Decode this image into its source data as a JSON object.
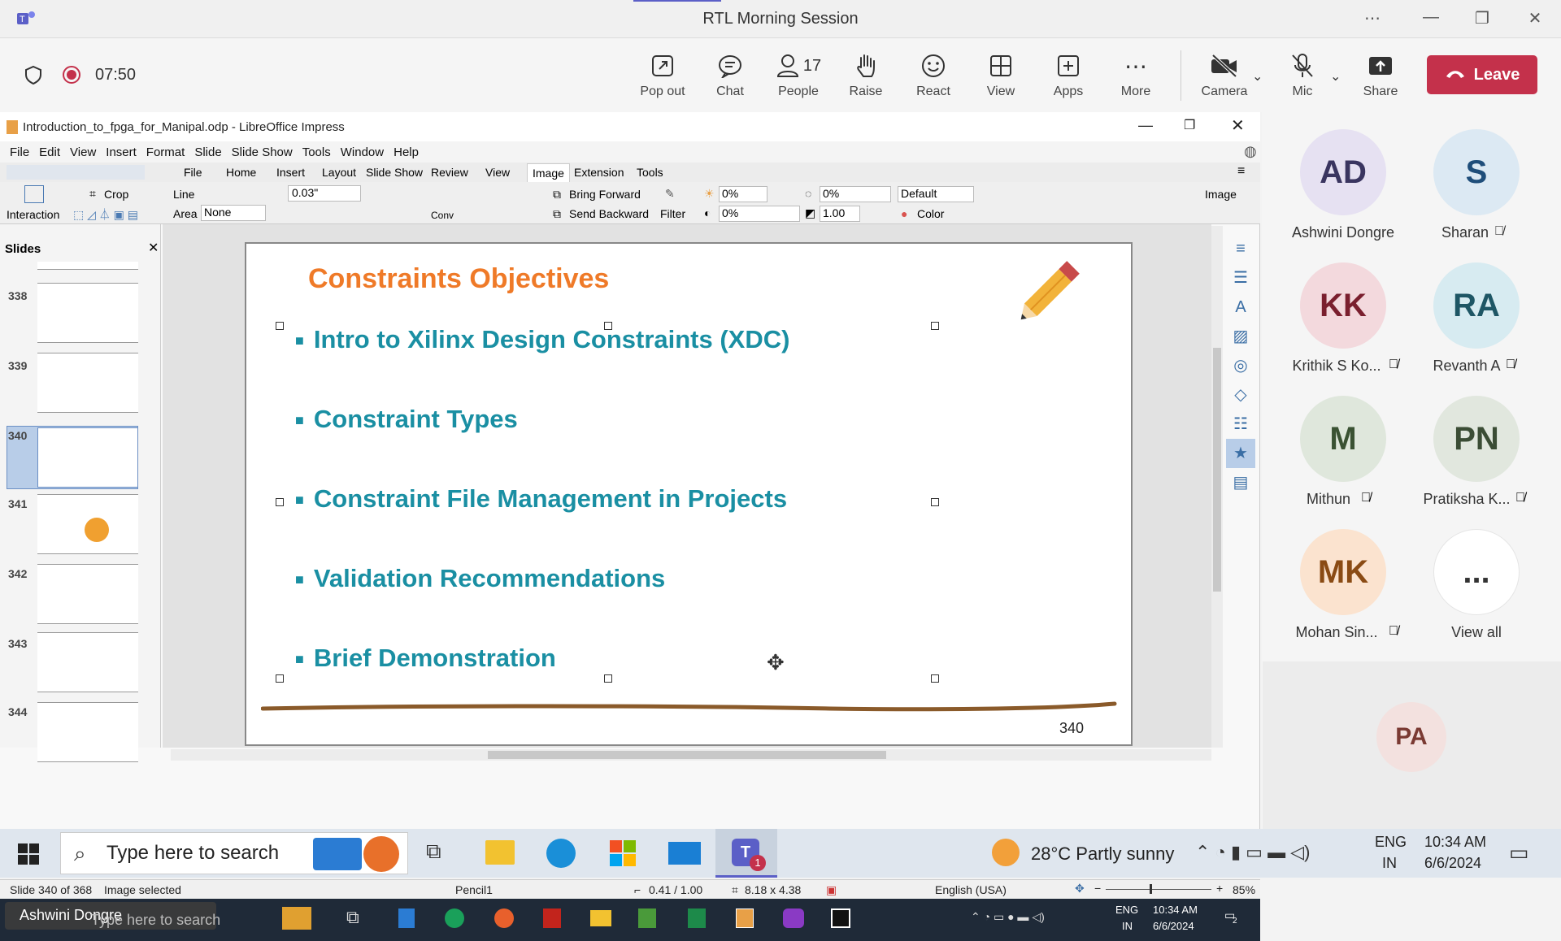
{
  "window": {
    "title": "RTL Morning Session",
    "icons": [
      "teams-icon",
      "more-icon",
      "minimize-icon",
      "restore-icon",
      "close-icon"
    ]
  },
  "meeting": {
    "timer": "07:50",
    "buttons": [
      {
        "label": "Pop out",
        "icon": "popout-icon"
      },
      {
        "label": "Chat",
        "icon": "chat-icon"
      },
      {
        "label": "People",
        "icon": "people-icon",
        "count": "17"
      },
      {
        "label": "Raise",
        "icon": "hand-icon"
      },
      {
        "label": "React",
        "icon": "smile-icon"
      },
      {
        "label": "View",
        "icon": "grid-icon"
      },
      {
        "label": "Apps",
        "icon": "plus-icon"
      },
      {
        "label": "More",
        "icon": "ellipsis-icon"
      },
      {
        "label": "Camera",
        "icon": "camera-off-icon"
      },
      {
        "label": "Mic",
        "icon": "mic-off-icon"
      },
      {
        "label": "Share",
        "icon": "share-icon"
      }
    ],
    "leave_label": "Leave"
  },
  "impress": {
    "doc_title": "Introduction_to_fpga_for_Manipal.odp - LibreOffice Impress",
    "menu": [
      "File",
      "Edit",
      "View",
      "Insert",
      "Format",
      "Slide",
      "Slide Show",
      "Tools",
      "Window",
      "Help"
    ],
    "tabs": [
      "File",
      "Home",
      "Insert",
      "Layout",
      "Slide Show",
      "Review",
      "View",
      "Image",
      "Extension",
      "Tools"
    ],
    "tools": {
      "interaction": "Interaction",
      "crop": "Crop",
      "line_label": "Line",
      "line_width": "0.03\"",
      "area_label": "Area",
      "area_value": "None",
      "conv": "Conv",
      "bring_forward": "Bring Forward",
      "send_backward": "Send Backward",
      "filter": "Filter",
      "bright": "0%",
      "contrast": "0%",
      "red": "0%",
      "gamma": "1.00",
      "mode": "Default",
      "color": "Color",
      "image": "Image"
    },
    "slides_panel": {
      "title": "Slides",
      "numbers": [
        "338",
        "339",
        "340",
        "341",
        "342",
        "343",
        "344"
      ],
      "selected": "340"
    },
    "slide": {
      "title": "Constraints Objectives",
      "bullets": [
        "Intro to Xilinx Design Constraints (XDC)",
        "Constraint Types",
        "Constraint File Management in Projects",
        "Validation Recommendations",
        "Brief Demonstration"
      ],
      "page_number": "340"
    },
    "status": {
      "slide": "Slide 340 of 368",
      "selection": "Image selected",
      "shape": "Pencil1",
      "position": "0.41 / 1.00",
      "size": "8.18 x 4.38",
      "language": "English (USA)",
      "zoom": "85%"
    },
    "inner_taskbar": {
      "presenter": "Ashwini Dongre",
      "search": "Type here to search",
      "lang": "ENG",
      "region": "IN",
      "time": "10:34 AM",
      "date": "6/6/2024",
      "notif": "2"
    }
  },
  "participants": [
    {
      "initials": "AD",
      "name": "Ashwini Dongre",
      "bg": "#e6e1f2",
      "fg": "#3a3560",
      "muted": false
    },
    {
      "initials": "S",
      "name": "Sharan",
      "bg": "#dce9f3",
      "fg": "#1f4e7a",
      "muted": true
    },
    {
      "initials": "KK",
      "name": "Krithik S Ko...",
      "bg": "#f3d9dd",
      "fg": "#7a1f2e",
      "muted": true
    },
    {
      "initials": "RA",
      "name": "Revanth A",
      "bg": "#d7ebf1",
      "fg": "#1e5665",
      "muted": true
    },
    {
      "initials": "M",
      "name": "Mithun",
      "bg": "#dfe7dc",
      "fg": "#3a5233",
      "muted": true
    },
    {
      "initials": "PN",
      "name": "Pratiksha K...",
      "bg": "#e1e7de",
      "fg": "#3b4d35",
      "muted": true
    },
    {
      "initials": "MK",
      "name": "Mohan Sin...",
      "bg": "#fbe3cf",
      "fg": "#8a4b14",
      "muted": true
    },
    {
      "initials": "...",
      "name": "View all",
      "bg": "#ffffff",
      "fg": "#333333",
      "muted": false
    }
  ],
  "presenter_tile": {
    "initials": "PA"
  },
  "taskbar": {
    "search": "Type here to search",
    "weather": "28°C  Partly sunny",
    "lang": "ENG",
    "region": "IN",
    "time": "10:34 AM",
    "date": "6/6/2024",
    "teams_badge": "1"
  }
}
